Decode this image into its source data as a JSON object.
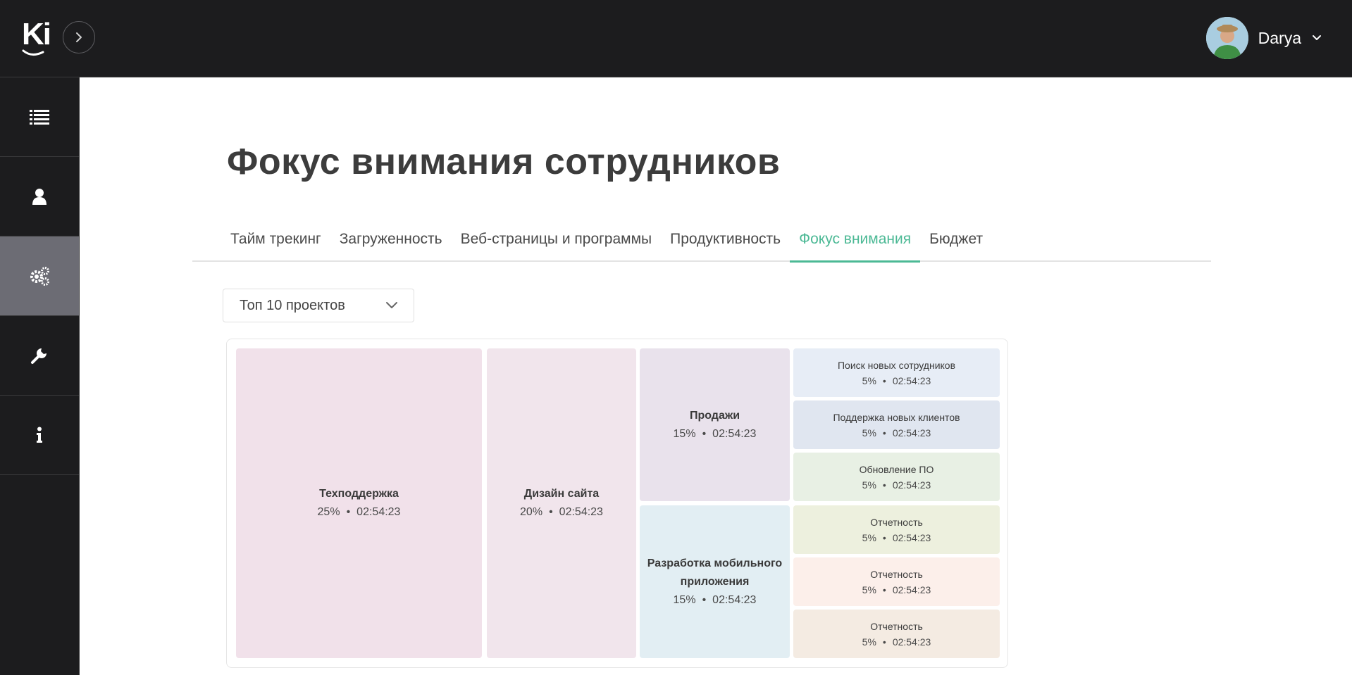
{
  "header": {
    "logo_text": "Ki",
    "user_name": "Darya"
  },
  "sidebar": {
    "items": [
      {
        "icon": "list-icon"
      },
      {
        "icon": "user-icon"
      },
      {
        "icon": "gears-icon",
        "active": true
      },
      {
        "icon": "wrench-icon"
      },
      {
        "icon": "info-icon"
      }
    ]
  },
  "page": {
    "title": "Фокус внимания сотрудников"
  },
  "tabs": [
    {
      "label": "Тайм трекинг"
    },
    {
      "label": "Загруженность"
    },
    {
      "label": "Веб-страницы и программы"
    },
    {
      "label": "Продуктивность"
    },
    {
      "label": "Фокус внимания",
      "active": true
    },
    {
      "label": "Бюджет"
    }
  ],
  "filter": {
    "selected": "Топ 10 проектов"
  },
  "chart_data": {
    "type": "treemap",
    "items": [
      {
        "name": "Техподдержка",
        "percent": "25%",
        "time": "02:54:23",
        "color": "#f1e1ea"
      },
      {
        "name": "Дизайн сайта",
        "percent": "20%",
        "time": "02:54:23",
        "color": "#f1e5ec"
      },
      {
        "name": "Продажи",
        "percent": "15%",
        "time": "02:54:23",
        "color": "#e9e2ec"
      },
      {
        "name": "Разработка мобильного приложения",
        "percent": "15%",
        "time": "02:54:23",
        "color": "#e2eef3"
      },
      {
        "name": "Поиск новых сотрудников",
        "percent": "5%",
        "time": "02:54:23",
        "color": "#e7edf6"
      },
      {
        "name": "Поддержка новых клиентов",
        "percent": "5%",
        "time": "02:54:23",
        "color": "#e0e6f0"
      },
      {
        "name": "Обновление ПО",
        "percent": "5%",
        "time": "02:54:23",
        "color": "#e8f0e4"
      },
      {
        "name": "Отчетность",
        "percent": "5%",
        "time": "02:54:23",
        "color": "#edf0de"
      },
      {
        "name": "Отчетность",
        "percent": "5%",
        "time": "02:54:23",
        "color": "#fcefea"
      },
      {
        "name": "Отчетность",
        "percent": "5%",
        "time": "02:54:23",
        "color": "#f4ebe2"
      }
    ]
  },
  "separator": "•"
}
